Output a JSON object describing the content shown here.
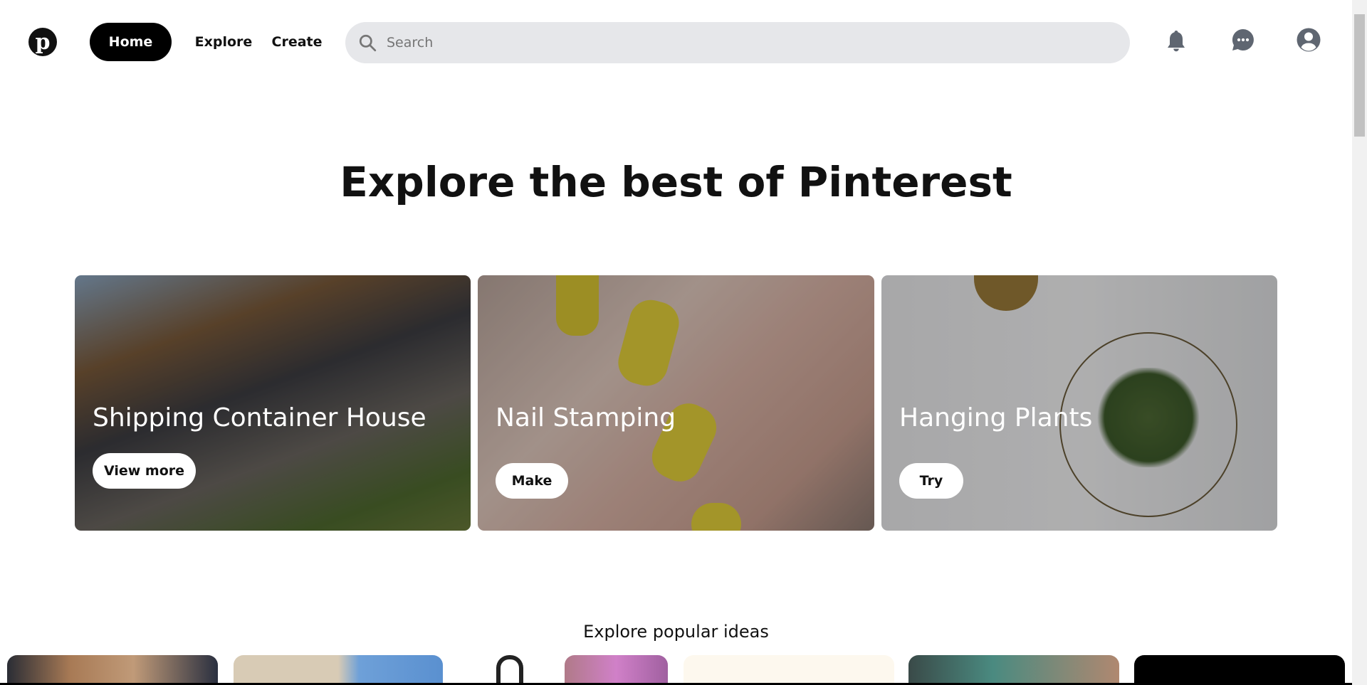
{
  "header": {
    "logo": "Pinterest",
    "nav": [
      "Home",
      "Explore",
      "Create"
    ],
    "active_nav": "Home",
    "search_placeholder": "Search",
    "icons": [
      "bell-icon",
      "chat-icon",
      "user-icon"
    ]
  },
  "main": {
    "title": "Explore the best of Pinterest",
    "cards": [
      {
        "title": "Shipping Container House",
        "button": "View more"
      },
      {
        "title": "Nail Stamping",
        "button": "Make"
      },
      {
        "title": "Hanging Plants",
        "button": "Try"
      }
    ],
    "popular_heading": "Explore popular ideas"
  }
}
